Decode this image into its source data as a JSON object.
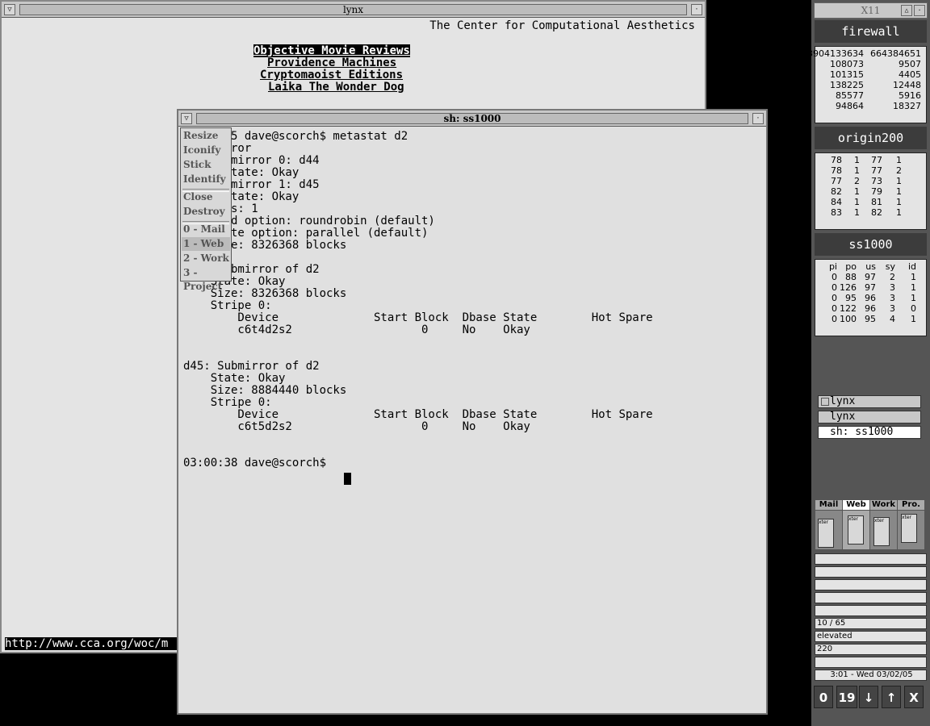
{
  "lynx": {
    "title": "lynx",
    "header": "The Center for Computational Aesthetics",
    "links": [
      "Objective Movie Reviews",
      "Providence Machines",
      "Cryptomaoist Editions",
      "Laika The Wonder Dog"
    ],
    "status_url": "http://www.cca.org/woc/m"
  },
  "xterm": {
    "title": "sh: ss1000",
    "lines": [
      "03:00:35 dave@scorch$ metastat d2",
      "d2: Mirror",
      "    Submirror 0: d44",
      "      State: Okay",
      "    Submirror 1: d45",
      "      State: Okay",
      "    Pass: 1",
      "    Read option: roundrobin (default)",
      "    Write option: parallel (default)",
      "    Size: 8326368 blocks",
      "",
      "d44: Submirror of d2",
      "    State: Okay",
      "    Size: 8326368 blocks",
      "    Stripe 0:",
      "        Device              Start Block  Dbase State        Hot Spare",
      "        c6t4d2s2                   0     No    Okay",
      "",
      "",
      "d45: Submirror of d2",
      "    State: Okay",
      "    Size: 8884440 blocks",
      "    Stripe 0:",
      "        Device              Start Block  Dbase State        Hot Spare",
      "        c6t5d2s2                   0     No    Okay",
      "",
      "",
      "03:00:38 dave@scorch$ "
    ]
  },
  "menu": {
    "items": [
      "Resize",
      "Iconify",
      "Stick",
      "Identify",
      "Close",
      "Destroy",
      "0 - Mail",
      "1 - Web",
      "2 - Work",
      "3 - Project"
    ]
  },
  "dock": {
    "title": "X11",
    "firewall": {
      "label": "firewall",
      "rows": [
        [
          "3904133634",
          "664384651"
        ],
        [
          "108073",
          "9507"
        ],
        [
          "101315",
          "4405"
        ],
        [
          "138225",
          "12448"
        ],
        [
          "85577",
          "5916"
        ],
        [
          "94864",
          "18327"
        ]
      ]
    },
    "origin": {
      "label": "origin200",
      "rows": [
        [
          "78",
          "1",
          "77",
          "1"
        ],
        [
          "78",
          "1",
          "77",
          "2"
        ],
        [
          "77",
          "2",
          "73",
          "1"
        ],
        [
          "82",
          "1",
          "79",
          "1"
        ],
        [
          "84",
          "1",
          "81",
          "1"
        ],
        [
          "83",
          "1",
          "82",
          "1"
        ]
      ]
    },
    "ss1000": {
      "label": "ss1000",
      "headers": [
        "pi",
        "po",
        "us",
        "sy",
        "id"
      ],
      "rows": [
        [
          "0",
          "88",
          "97",
          "2",
          "1"
        ],
        [
          "0",
          "126",
          "97",
          "3",
          "1"
        ],
        [
          "0",
          "95",
          "96",
          "3",
          "1"
        ],
        [
          "0",
          "122",
          "96",
          "3",
          "0"
        ],
        [
          "0",
          "100",
          "95",
          "4",
          "1"
        ]
      ]
    },
    "tasks": [
      "lynx",
      "lynx",
      "sh: ss1000"
    ],
    "pager": {
      "tabs": [
        "Mail",
        "Web",
        "Work",
        "Pro."
      ],
      "mini": [
        "xter",
        "xter",
        "xter",
        "xter"
      ]
    },
    "info": [
      "10 / 65",
      "elevated",
      "220"
    ],
    "clock": "3:01 - Wed 03/02/05",
    "buttons": [
      "0",
      "19",
      "↓",
      "↑",
      "X"
    ]
  }
}
